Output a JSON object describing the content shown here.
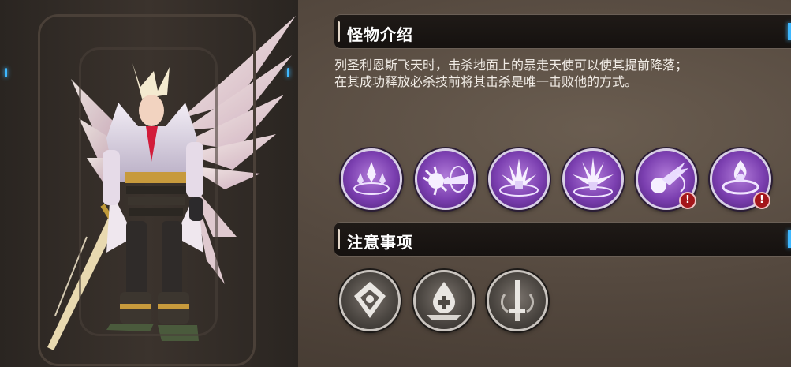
{
  "intro": {
    "title": "怪物介绍",
    "line1": "列圣利恩斯飞天时，击杀地面上的暴走天使可以使其提前降落；",
    "line2": "在其成功释放必杀技前将其击杀是唯一击败他的方式。"
  },
  "skills": [
    {
      "icon": "crystal-shards-icon",
      "warning": false
    },
    {
      "icon": "spiked-spin-icon",
      "warning": false
    },
    {
      "icon": "ground-burst-icon",
      "warning": false
    },
    {
      "icon": "impact-burst-icon",
      "warning": false
    },
    {
      "icon": "comet-dash-icon",
      "warning": true
    },
    {
      "icon": "flame-ring-icon",
      "warning": true
    }
  ],
  "warning_mark": "!",
  "notes": {
    "title": "注意事项",
    "items": [
      {
        "icon": "shield-emblem-icon"
      },
      {
        "icon": "healing-drop-icon"
      },
      {
        "icon": "sword-crest-icon"
      }
    ]
  },
  "colors": {
    "accent_blue": "#3fb8ff",
    "skill_purple": "#7b3fb0",
    "warning_red": "#a4161a",
    "header_bg": "#15110f"
  }
}
